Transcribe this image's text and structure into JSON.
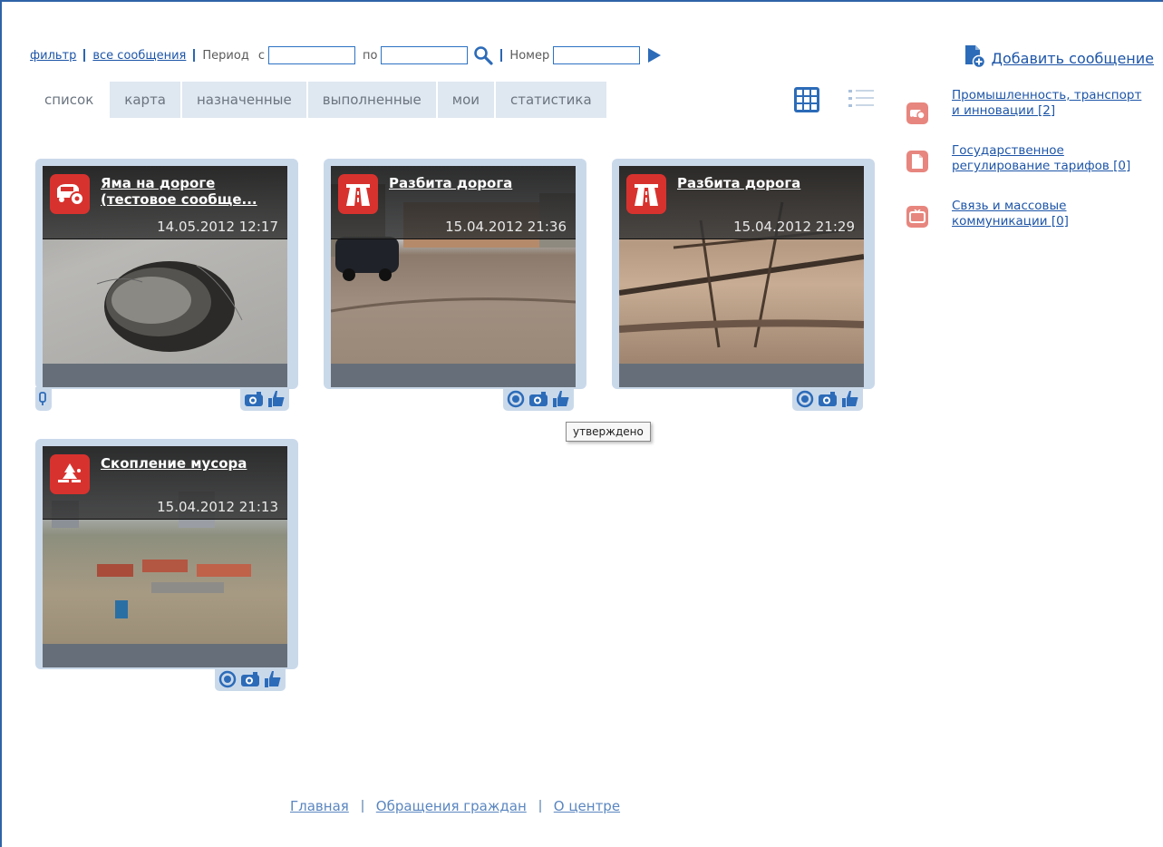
{
  "toolbar": {
    "filter": "фильтр",
    "all_messages": "все сообщения",
    "period": "Период",
    "from": "с",
    "to": "по",
    "number": "Номер",
    "from_value": "",
    "to_value": "",
    "number_value": ""
  },
  "add_message": "Добавить сообщение",
  "tabs": [
    "список",
    "карта",
    "назначенные",
    "выполненные",
    "мои",
    "статистика"
  ],
  "categories": [
    {
      "label": "Промышленность, транспорт и инновации [2]",
      "icon": "car-gear-icon"
    },
    {
      "label": "Государственное регулирование тарифов [0]",
      "icon": "document-icon"
    },
    {
      "label": "Связь и массовые коммуникации [0]",
      "icon": "tv-icon"
    }
  ],
  "cards": [
    {
      "title": "Яма на дороге (тестовое сообще...",
      "date": "14.05.2012 12:17",
      "category_icon": "car-gear-icon",
      "status": ""
    },
    {
      "title": "Разбита дорога",
      "date": "15.04.2012 21:36",
      "category_icon": "road-icon",
      "status": "утверждено"
    },
    {
      "title": "Разбита дорога",
      "date": "15.04.2012 21:29",
      "category_icon": "road-icon",
      "status": ""
    },
    {
      "title": "Скопление мусора",
      "date": "15.04.2012 21:13",
      "category_icon": "trash-tree-icon",
      "status": ""
    }
  ],
  "tooltip": "утверждено",
  "footer": [
    "Главная",
    "Обращения граждан",
    "О центре"
  ],
  "colors": {
    "accent": "#2c6bb8",
    "badge": "#d8322e",
    "card_frame": "#cad9ea",
    "tab_bg": "#dfe7f0"
  }
}
